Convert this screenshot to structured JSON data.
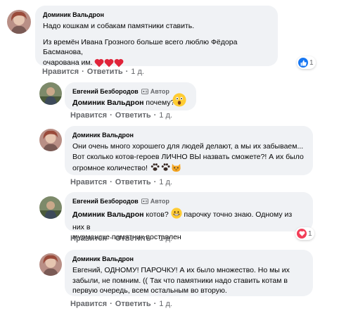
{
  "comments": [
    {
      "author": "Доминик Вальдрон",
      "p1": "Надо кошкам и собакам памятники ставить.",
      "p2a": "Из времён Ивана Грозного больше всего люблю Фёдора Басманова,",
      "p2b": "очарована им.",
      "reaction_count": "1"
    },
    {
      "author": "Евгений Безбородов",
      "badge": "Автор",
      "mention": "Доминик Вальдрон",
      "text": " почему?"
    },
    {
      "author": "Доминик Вальдрон",
      "l1": "Они очень много хорошего для людей делают, а мы их забываем...",
      "l2": "Вот сколько котов-героев ЛИЧНО ВЫ назвать сможете?! А их было",
      "l3": "огромное количество!"
    },
    {
      "author": "Евгений Безбородов",
      "badge": "Автор",
      "mention": "Доминик Вальдрон",
      "t1": " котов? ",
      "t2": " парочку точно знаю. Одному из них в",
      "l2": "мурманске памятник поставлен",
      "reaction_count": "1"
    },
    {
      "author": "Доминик Вальдрон",
      "l1": "Евгений, ОДНОМУ! ПАРОЧКУ! А их было множество. Но мы их",
      "l2": "забыли, не помним. (( Так что памятники надо ставить котам в",
      "l3": "первую очередь, всем остальным во вторую."
    }
  ],
  "actions": {
    "like": "Нравится",
    "reply": "Ответить",
    "sep": "·",
    "time": "1 д."
  },
  "colors": {
    "bubble": "#f0f2f5",
    "meta": "#65676b",
    "like_blue": "#1877f2",
    "heart_red": "#f33e58"
  }
}
